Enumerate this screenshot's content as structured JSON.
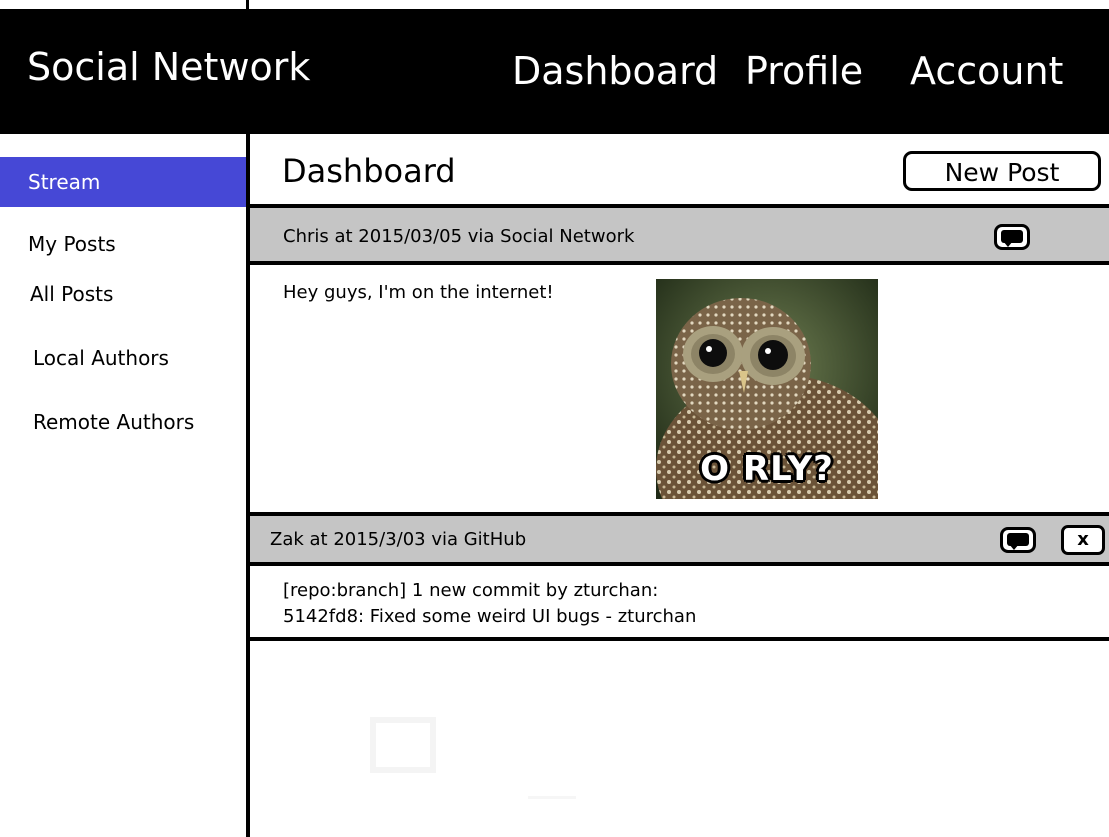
{
  "app": {
    "brand": "Social Network"
  },
  "nav": {
    "items": [
      {
        "label": "Dashboard"
      },
      {
        "label": "Profile"
      },
      {
        "label": "Account"
      }
    ]
  },
  "sidebar": {
    "items": [
      {
        "label": "Stream",
        "active": true
      },
      {
        "label": "My Posts"
      },
      {
        "label": "All Posts"
      },
      {
        "label": "Local Authors"
      },
      {
        "label": "Remote Authors"
      }
    ]
  },
  "main": {
    "title": "Dashboard",
    "new_post_label": "New Post"
  },
  "posts": [
    {
      "meta": "Chris at 2015/03/05 via Social Network",
      "body": "Hey guys, I'm on the internet!",
      "image_caption": "O RLY?",
      "icons": [
        "comment-icon"
      ]
    },
    {
      "meta": "Zak at 2015/3/03 via GitHub",
      "body_lines": [
        "[repo:branch] 1 new commit by zturchan:",
        "5142fd8: Fixed some weird UI bugs - zturchan"
      ],
      "delete_label": "x",
      "icons": [
        "comment-icon",
        "delete-icon"
      ]
    }
  ],
  "colors": {
    "header_bg": "#000000",
    "active_sidebar": "#4648d6",
    "post_header_bg": "#c5c5c5"
  }
}
